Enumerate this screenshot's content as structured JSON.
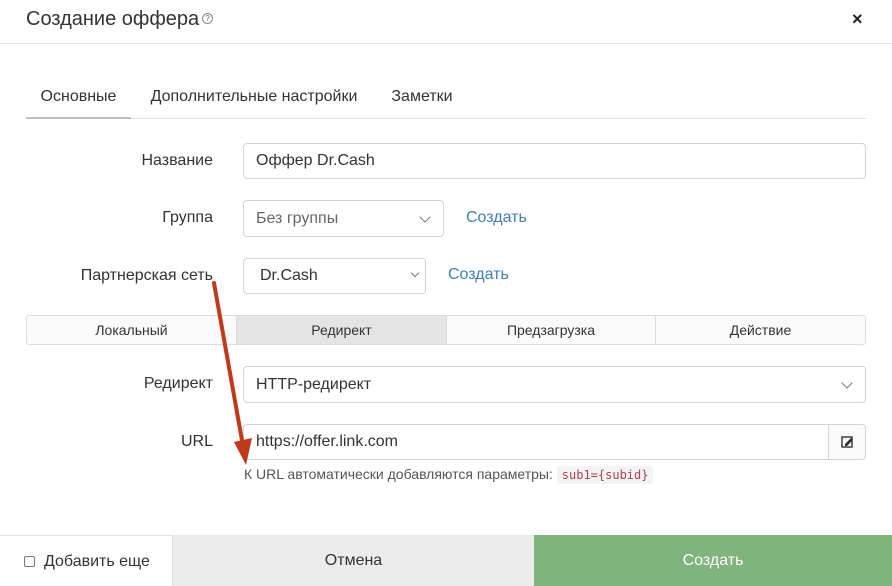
{
  "dialog": {
    "title": "Создание оффера",
    "help_icon": "question-circle-icon",
    "close_label": "×"
  },
  "tabs": [
    {
      "label": "Основные",
      "active": true
    },
    {
      "label": "Дополнительные настройки",
      "active": false
    },
    {
      "label": "Заметки",
      "active": false
    }
  ],
  "form": {
    "name": {
      "label": "Название",
      "value": "Оффер Dr.Cash"
    },
    "group": {
      "label": "Группа",
      "value": "Без группы",
      "create_link": "Создать"
    },
    "network": {
      "label": "Партнерская сеть",
      "value": "Dr.Cash",
      "create_link": "Создать"
    },
    "modes": [
      {
        "label": "Локальный",
        "active": false
      },
      {
        "label": "Редирект",
        "active": true
      },
      {
        "label": "Предзагрузка",
        "active": false
      },
      {
        "label": "Действие",
        "active": false
      }
    ],
    "redirect": {
      "label": "Редирект",
      "value": "HTTP-редирект"
    },
    "url": {
      "label": "URL",
      "value": "https://offer.link.com",
      "edit_icon": "edit-icon",
      "hint_text": "К URL автоматически добавляются параметры:",
      "hint_code": "sub1={subid}"
    }
  },
  "footer": {
    "add_more_label": "Добавить еще",
    "add_more_checked": false,
    "cancel_label": "Отмена",
    "create_label": "Создать"
  },
  "colors": {
    "accent_link": "#3d7ebf",
    "create_button": "#7fb57c",
    "annotation_arrow": "#c0391b"
  }
}
